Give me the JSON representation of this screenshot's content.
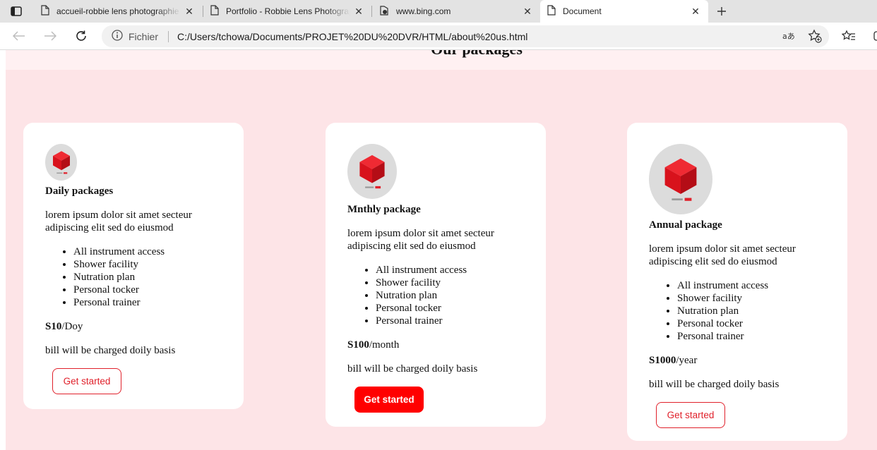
{
  "browser": {
    "tabs": [
      {
        "title": "accueil-robbie lens photographie",
        "icon": "page-icon"
      },
      {
        "title": "Portfolio - Robbie Lens Photography",
        "icon": "page-icon"
      },
      {
        "title": "www.bing.com",
        "icon": "bing-icon"
      },
      {
        "title": "Document",
        "icon": "page-icon",
        "active": true
      }
    ],
    "address": {
      "site_label": "Fichier",
      "url": "C:/Users/tchowa/Documents/PROJET%20DU%20DVR/HTML/about%20us.html"
    }
  },
  "page": {
    "section_heading": "Our packages",
    "cards": [
      {
        "title": "Daily packages",
        "description": "lorem ipsum dolor sit amet secteur adipiscing elit sed do eiusmod",
        "features": [
          "All instrument access",
          "Shower facility",
          "Nutration plan",
          "Personal tocker",
          "Personal trainer"
        ],
        "price": "S10",
        "period": "/Doy",
        "billing": "bill will be charged doily basis",
        "button": "Get started",
        "button_style": "outline"
      },
      {
        "title": "Mnthly package",
        "description": "lorem ipsum dolor sit amet secteur adipiscing elit sed do eiusmod",
        "features": [
          "All instrument access",
          "Shower facility",
          "Nutration plan",
          "Personal tocker",
          "Personal trainer"
        ],
        "price": "S100",
        "period": "/month",
        "billing": "bill will be charged doily basis",
        "button": "Get started",
        "button_style": "solid"
      },
      {
        "title": "Annual package",
        "description": "lorem ipsum dolor sit amet secteur adipiscing elit sed do eiusmod",
        "features": [
          "All instrument access",
          "Shower facility",
          "Nutration plan",
          "Personal tocker",
          "Personal trainer"
        ],
        "price": "S1000",
        "period": "/year",
        "billing": "bill will be charged doily basis",
        "button": "Get started",
        "button_style": "outline"
      }
    ]
  },
  "colors": {
    "section_bg": "#fde4e7",
    "accent_red": "#ff0000",
    "cube_red": "#d8121c"
  }
}
